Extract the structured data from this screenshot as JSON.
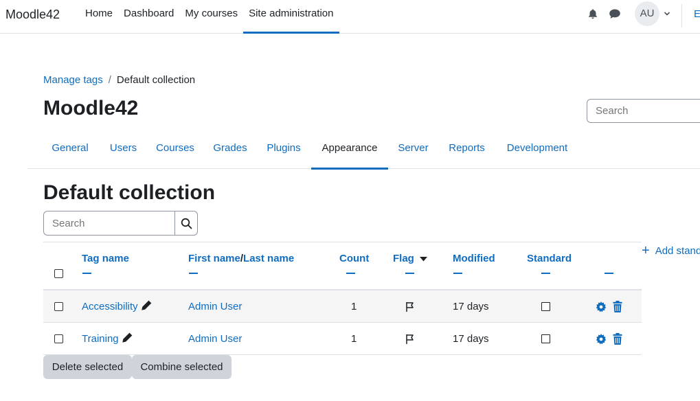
{
  "navbar": {
    "brand": "Moodle42",
    "items": [
      "Home",
      "Dashboard",
      "My courses",
      "Site administration"
    ],
    "active_index": 3,
    "avatar": "AU",
    "edit_letter": "E",
    "icons": [
      "bell-icon",
      "chat-icon",
      "chevron-down-icon"
    ]
  },
  "breadcrumb": {
    "items": [
      "Manage tags",
      "Default collection"
    ],
    "separator": "/"
  },
  "site_title": "Moodle42",
  "top_search": {
    "placeholder": "Search"
  },
  "tabs": {
    "items": [
      "General",
      "Users",
      "Courses",
      "Grades",
      "Plugins",
      "Appearance",
      "Server",
      "Reports",
      "Development"
    ],
    "active_index": 5
  },
  "page_heading": "Default collection",
  "table_search": {
    "placeholder": "Search",
    "icon": "search-icon"
  },
  "add_standard": "Add stand",
  "table": {
    "headers": {
      "tag_name": "Tag name",
      "first_name": "First name",
      "name_sep": "/",
      "last_name": "Last name",
      "count": "Count",
      "flag": "Flag",
      "modified": "Modified",
      "standard": "Standard"
    },
    "rows": [
      {
        "tag": "Accessibility",
        "user": "Admin User",
        "count": "1",
        "modified": "17 days"
      },
      {
        "tag": "Training",
        "user": "Admin User",
        "count": "1",
        "modified": "17 days"
      }
    ]
  },
  "buttons": {
    "delete": "Delete selected",
    "combine": "Combine selected"
  },
  "colors": {
    "link": "#0f6cbf",
    "text": "#1d2125",
    "button_bg": "#ced4da"
  }
}
